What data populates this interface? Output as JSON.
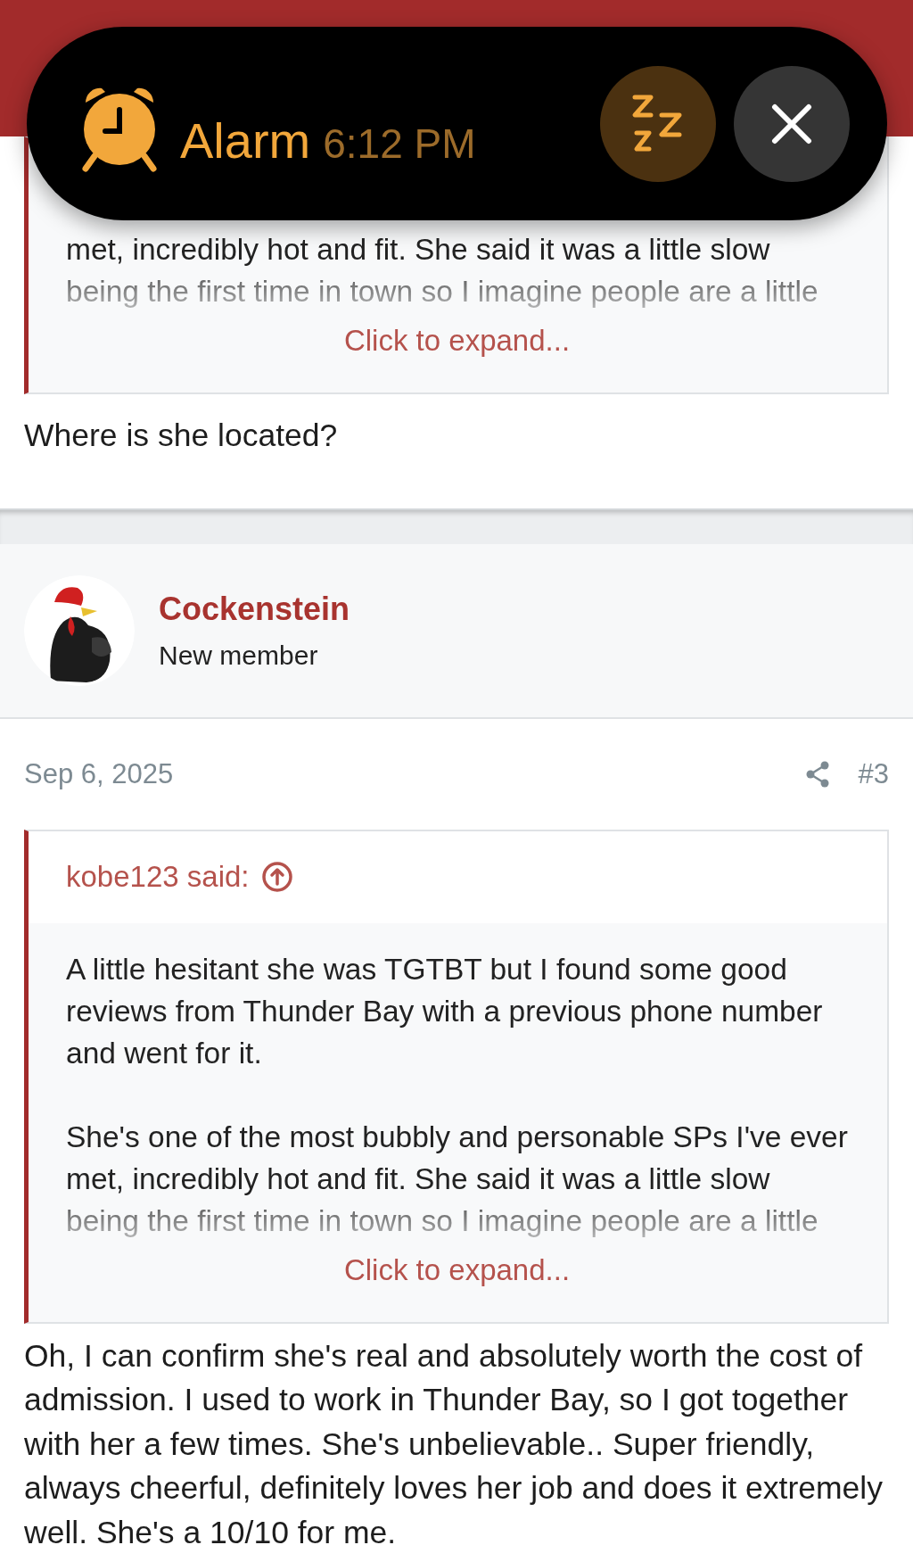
{
  "alarm_banner": {
    "kind": "alarm",
    "title": "Alarm",
    "time": "6:12 PM",
    "buttons": [
      {
        "kind": "snooze"
      },
      {
        "kind": "close"
      }
    ]
  },
  "posts": [
    {
      "quote": {
        "paragraphs": [
          "met, incredibly hot and fit. She said it was a little slow being the first time in town so I imagine people are a little"
        ],
        "expand": "Click to expand..."
      },
      "message": "Where is she located?"
    },
    {
      "author": {
        "name": "Cockenstein",
        "title": "New member"
      },
      "date": "Sep 6, 2025",
      "number": "#3",
      "quote": {
        "attribution": "kobe123 said:",
        "paragraphs": [
          "A little hesitant she was TGTBT but I found some good reviews from Thunder Bay with a previous phone number and went for it.",
          "She's one of the most bubbly and personable SPs I've ever met, incredibly hot and fit. She said it was a little slow being the first time in town so I imagine people are a little"
        ],
        "expand": "Click to expand..."
      },
      "message": "Oh, I can confirm she's real and absolutely worth the cost of admission. I used to work in Thunder Bay, so I got together with her a few times. She's unbelievable.. Super friendly, always cheerful, definitely loves her job and does it extremely well. She's a 10/10 for me."
    }
  ]
}
